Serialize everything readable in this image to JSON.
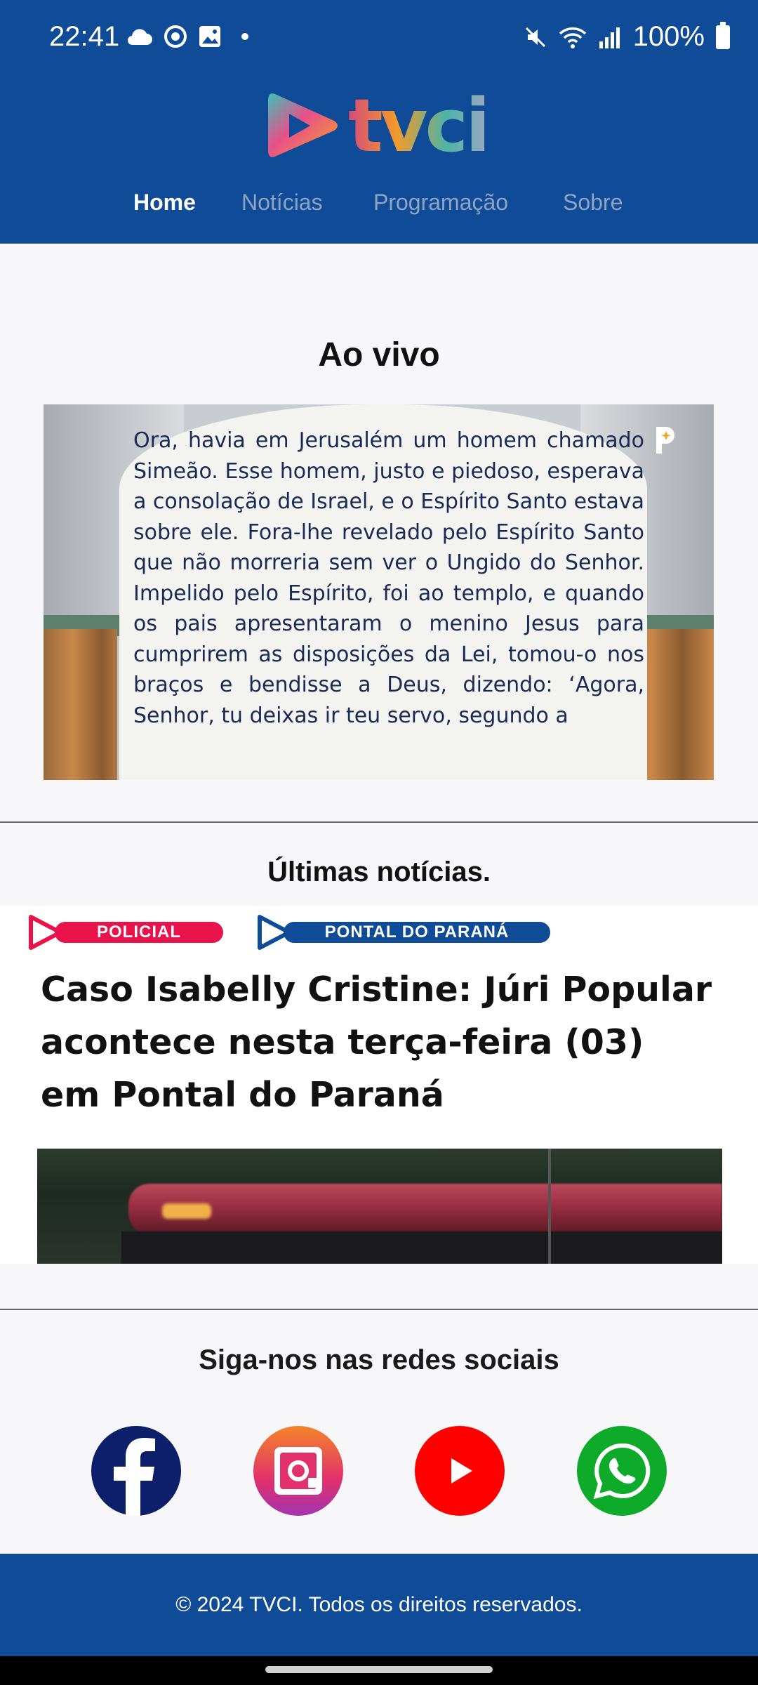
{
  "status_bar": {
    "time": "22:41",
    "battery": "100%",
    "icons_left": [
      "cloud-icon",
      "sync-icon",
      "image-icon",
      "dot-icon"
    ],
    "icons_right": [
      "mute-icon",
      "wifi-icon",
      "signal-icon",
      "battery-icon"
    ]
  },
  "brand": {
    "logo_text": "tvci",
    "primary_color": "#0f4b96"
  },
  "nav": {
    "items": [
      {
        "label": "Home",
        "active": true
      },
      {
        "label": "Notícias",
        "active": false
      },
      {
        "label": "Programação",
        "active": false
      },
      {
        "label": "Sobre",
        "active": false
      }
    ]
  },
  "live": {
    "title": "Ao vivo",
    "video_text": "Ora, havia em Jerusalém um homem chamado Simeão. Esse homem, justo e piedoso, esperava a consolação de Israel, e o Espírito Santo estava sobre ele. Fora-lhe revelado pelo Espírito Santo que não morreria sem ver o Ungido do Senhor. Impelido pelo Espírito, foi ao templo, e quando os pais apresentaram o menino Jesus para cumprirem as disposições da Lei, tomou-o nos braços e bendisse a Deus, dizendo: ‘Agora, Senhor, tu deixas ir teu servo, segundo a"
  },
  "news": {
    "heading": "Últimas notícias.",
    "tags": [
      {
        "label": "POLICIAL",
        "color": "#e8134a"
      },
      {
        "label": "PONTAL DO PARANÁ",
        "color": "#0f4b96"
      }
    ],
    "headline": "Caso Isabelly Cristine: Júri Popular acontece nesta terça-feira (03) em Pontal do Paraná"
  },
  "social": {
    "heading": "Siga-nos nas redes sociais",
    "links": [
      "facebook-icon",
      "instagram-icon",
      "youtube-icon",
      "whatsapp-icon"
    ]
  },
  "footer": {
    "text": "© 2024 TVCI. Todos os direitos reservados."
  }
}
